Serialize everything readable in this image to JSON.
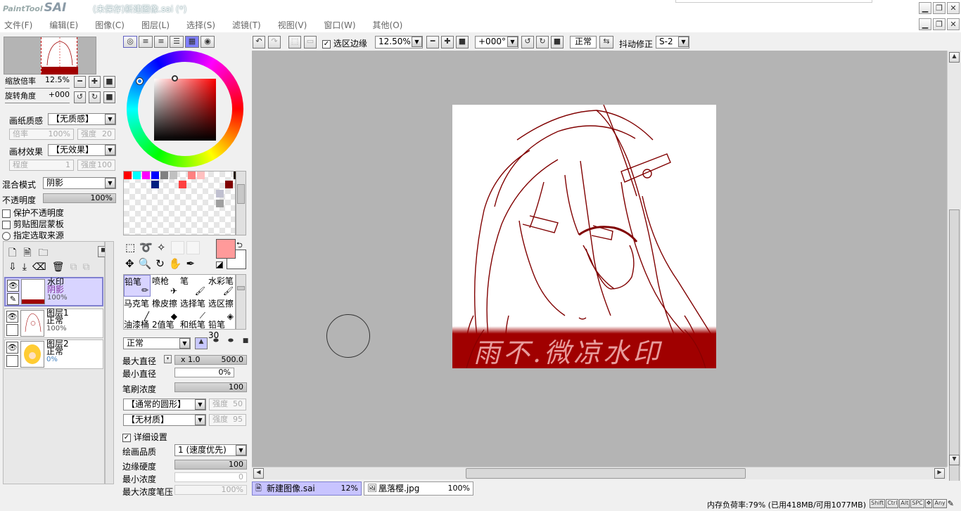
{
  "app": {
    "logo_small": "PaintTool",
    "logo_big": "SAI",
    "title": "(未保存)新建图像.sai (*)"
  },
  "window_buttons": [
    "▁",
    "❐",
    "✕"
  ],
  "menu": [
    "文件(F)",
    "编辑(E)",
    "图像(C)",
    "图层(L)",
    "选择(S)",
    "滤镜(T)",
    "视图(V)",
    "窗口(W)",
    "其他(O)"
  ],
  "navigator": {
    "zoom_label": "缩放倍率",
    "zoom_value": "12.5%",
    "rotate_label": "旋转角度",
    "rotate_value": "+000"
  },
  "paper": {
    "texture_label": "画纸质感",
    "texture_value": "【无质感】",
    "scale_label": "倍率",
    "scale_value": "100%",
    "strength_label": "强度",
    "strength_value": "20",
    "effect_label": "画材效果",
    "effect_value": "【无效果】",
    "degree_label": "程度",
    "degree_value": "1",
    "strength2_label": "强度",
    "strength2_value": "100"
  },
  "layer_props": {
    "blend_label": "混合模式",
    "blend_value": "阴影",
    "opacity_label": "不透明度",
    "opacity_value": "100%",
    "opt_protect": "保护不透明度",
    "opt_clip": "剪贴图层蒙板",
    "opt_source": "指定选取来源"
  },
  "layers": [
    {
      "name": "水印",
      "mode": "阴影",
      "opacity": "100%"
    },
    {
      "name": "图层1",
      "mode": "正常",
      "opacity": "100%"
    },
    {
      "name": "图层2",
      "mode": "正常",
      "opacity": "0%"
    }
  ],
  "tools": {
    "row1": [
      "铅笔",
      "喷枪",
      "笔",
      "水彩笔"
    ],
    "row2": [
      "马克笔",
      "橡皮擦",
      "选择笔",
      "选区擦"
    ],
    "row3": [
      "油漆桶",
      "2值笔",
      "和纸笔",
      "铅笔30"
    ]
  },
  "brush": {
    "mode": "正常",
    "max_size_label": "最大直径",
    "max_size_mult": "x 1.0",
    "max_size_value": "500.0",
    "min_size_label": "最小直径",
    "min_size_value": "0%",
    "density_label": "笔刷浓度",
    "density_value": "100",
    "shape": "【通常的圆形】",
    "shape_strength_label": "强度",
    "shape_strength_value": "50",
    "texture": "【无材质】",
    "texture_strength_label": "强度",
    "texture_strength_value": "95",
    "advanced_label": "详细设置",
    "quality_label": "绘画品质",
    "quality_value": "1 (速度优先)",
    "edge_label": "边缘硬度",
    "edge_value": "100",
    "min_density_label": "最小浓度",
    "min_density_value": "0",
    "max_pressure_label": "最大浓度笔压",
    "max_pressure_value": "100%"
  },
  "canvas_toolbar": {
    "selection_edge_label": "选区边缘",
    "zoom": "12.50%",
    "rotate": "+000°",
    "blend": "正常",
    "stabilizer_label": "抖动修正",
    "stabilizer_value": "S-2"
  },
  "canvas": {
    "watermark_text": "雨不.微凉水印"
  },
  "tabs": [
    {
      "name": "新建图像.sai",
      "zoom": "12%"
    },
    {
      "name": "凰落樱.jpg",
      "zoom": "100%"
    }
  ],
  "status": {
    "memory": "内存负荷率:79% (已用418MB/可用1077MB)",
    "keys": [
      "Shift",
      "Ctrl",
      "Alt",
      "SPC",
      "Any"
    ]
  },
  "colors": {
    "accent": "#8080d0",
    "primary_color": "#ff9a9a",
    "watermark_red": "#a00000",
    "canvas_bg": "#b4b4b4",
    "swatches": [
      "#ff0000",
      "#00ffff",
      "#ff00ff",
      "#0000ff",
      "#808080",
      "#c0c0c0",
      "#ff8080",
      "#ffc0c0",
      "#000000",
      "#000000",
      "#002080",
      "#ff4040",
      "#800000",
      "#c0c0d0",
      "#a0a0a0"
    ]
  }
}
